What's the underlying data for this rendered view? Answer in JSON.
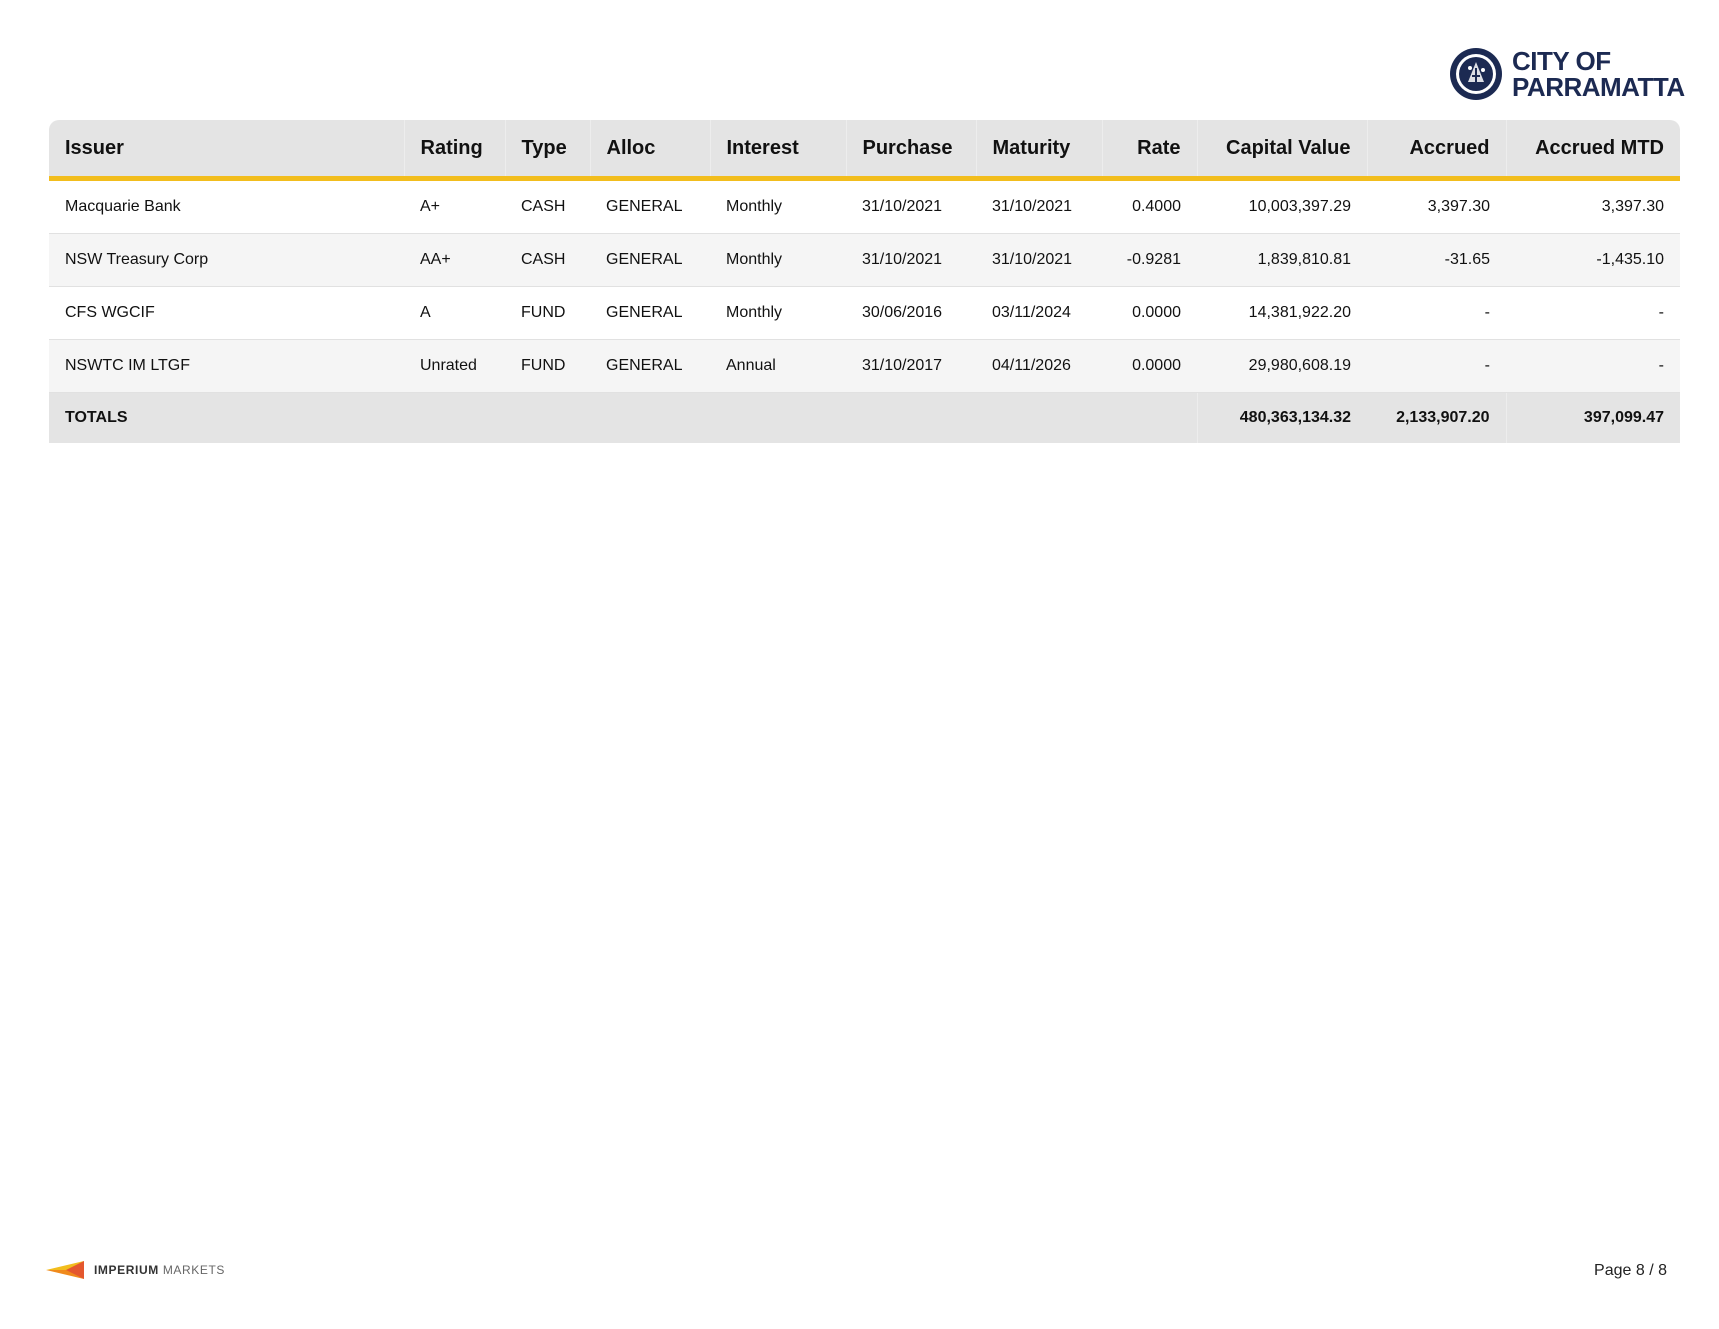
{
  "brand": {
    "line1": "CITY OF",
    "line2": "PARRAMATTA"
  },
  "table": {
    "columns": [
      "Issuer",
      "Rating",
      "Type",
      "Alloc",
      "Interest",
      "Purchase",
      "Maturity",
      "Rate",
      "Capital Value",
      "Accrued",
      "Accrued MTD"
    ],
    "rows": [
      [
        "Macquarie Bank",
        "A+",
        "CASH",
        "GENERAL",
        "Monthly",
        "31/10/2021",
        "31/10/2021",
        "0.4000",
        "10,003,397.29",
        "3,397.30",
        "3,397.30"
      ],
      [
        "NSW Treasury Corp",
        "AA+",
        "CASH",
        "GENERAL",
        "Monthly",
        "31/10/2021",
        "31/10/2021",
        "-0.9281",
        "1,839,810.81",
        "-31.65",
        "-1,435.10"
      ],
      [
        "CFS WGCIF",
        "A",
        "FUND",
        "GENERAL",
        "Monthly",
        "30/06/2016",
        "03/11/2024",
        "0.0000",
        "14,381,922.20",
        "-",
        "-"
      ],
      [
        "NSWTC IM LTGF",
        "Unrated",
        "FUND",
        "GENERAL",
        "Annual",
        "31/10/2017",
        "04/11/2026",
        "0.0000",
        "29,980,608.19",
        "-",
        "-"
      ]
    ],
    "totals": {
      "label": "TOTALS",
      "capital_value": "480,363,134.32",
      "accrued": "2,133,907.20",
      "accrued_mtd": "397,099.47"
    }
  },
  "footer": {
    "logo_strong": "IMPERIUM",
    "logo_light": "MARKETS",
    "page": "Page 8 / 8"
  },
  "colors": {
    "accent": "#f2bd1d",
    "brand_navy": "#1c2a52",
    "header_bg": "#e4e4e4",
    "alt_row_bg": "#f5f5f5"
  }
}
